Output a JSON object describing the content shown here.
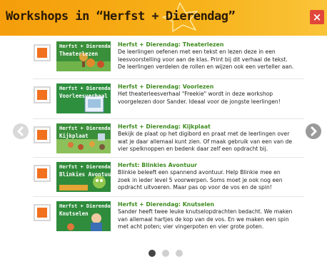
{
  "header": {
    "title": "Workshops in “Herfst + Dierendag”",
    "close_label": "×",
    "color_start": "#f59d0b",
    "color_end": "#fac43a"
  },
  "accent": {
    "checkbox": "#f1711f",
    "title_green": "#3e8c20",
    "close": "#e0463a"
  },
  "workshops": [
    {
      "thumb_line1": "Herfst + Dierendag",
      "thumb_line2": "Theaterlezen",
      "title": "Herfst + Dierendag: Theaterlezen",
      "desc": [
        "De leerlingen oefenen met een tekst en lezen deze in een",
        "leesvoorstelling voor aan de klas. Print bij dit verhaal de tekst.",
        "De leerlingen verdelen de rollen en wijzen ook een verteller aan."
      ],
      "selected": true
    },
    {
      "thumb_line1": "Herfst + Dierendag",
      "thumb_line2": "Voorleesverhaal",
      "title": "Herfst + Dierendag: Voorlezen",
      "desc": [
        "Het theaterleesverhaal \"Freekie\" wordt in deze workshop",
        "voorgelezen door Sander. Ideaal voor de jongste leerlingen!"
      ],
      "selected": true
    },
    {
      "thumb_line1": "Herfst + Dierendag",
      "thumb_line2": "Kijkplaat",
      "title": "Herfst + Dierendag: Kijkplaat",
      "desc": [
        "Bekijk de plaat op het digibord en praat met de leerlingen over",
        "wat je daar allemaal kunt zien. Of maak gebruik van een van de",
        "vier spelknoppen en bedenk daar zelf een opdracht bij."
      ],
      "selected": true
    },
    {
      "thumb_line1": "Herfst + Dierendag",
      "thumb_line2": "Blinkies Avontuur",
      "title": "Herfst: Blinkies Avontuur",
      "desc": [
        "Blinkie beleeft een spannend avontuur. Help Blinkie mee en",
        "zoek in ieder level 5 voorwerpen. Soms moet je ook nog een",
        "opdracht uitvoeren. Maar pas op voor de vos en de spin!"
      ],
      "selected": true
    },
    {
      "thumb_line1": "Herfst + Dierendag",
      "thumb_line2": "Knutselen",
      "title": "Herfst + Dierendag: Knutselen",
      "desc": [
        "Sander heeft twee leuke knutselopdrachten bedacht. We maken",
        "van allemaal hartjes de kop van de vos. En we maken een spin",
        "met acht poten; vier vingerpoten en vier grote poten."
      ],
      "selected": true
    }
  ],
  "pagination": {
    "pages": 3,
    "current": 1
  }
}
